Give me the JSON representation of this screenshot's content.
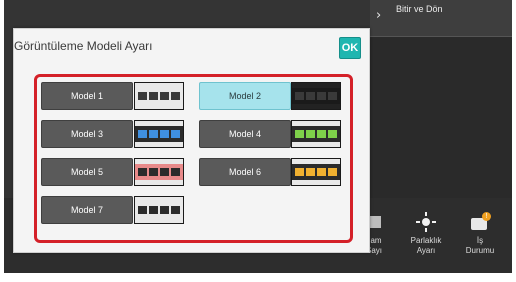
{
  "header": {
    "right_button_label": "Bitir ve Dön"
  },
  "dialog": {
    "title": "Görüntüleme Modeli Ayarı",
    "ok_label": "OK",
    "selected_model": "Model 2",
    "models": [
      {
        "label": "Model 1",
        "swatch": {
          "band": "#e9e9e9",
          "body": "#e9e9e9",
          "key": "#3a3a3a"
        }
      },
      {
        "label": "Model 2",
        "swatch": {
          "band": "#222222",
          "body": "#1a1a1a",
          "key": "#3a3a3a"
        }
      },
      {
        "label": "Model 3",
        "swatch": {
          "band": "#e9e9e9",
          "body": "#2b2b2b",
          "key": "#3f8fe0"
        }
      },
      {
        "label": "Model 4",
        "swatch": {
          "band": "#e9e9e9",
          "body": "#2b2b2b",
          "key": "#7ed04a"
        }
      },
      {
        "label": "Model 5",
        "swatch": {
          "band": "#e9e9e9",
          "body": "#e88a8a",
          "key": "#2b2b2b"
        }
      },
      {
        "label": "Model 6",
        "swatch": {
          "band": "#e9e9e9",
          "body": "#2b2b2b",
          "key": "#f0b030"
        }
      },
      {
        "label": "Model 7",
        "swatch": {
          "band": "#e9e9e9",
          "body": "#e9e9e9",
          "key": "#2b2b2b"
        }
      }
    ]
  },
  "bottom_bar": {
    "items": [
      {
        "label_line1": "ılam",
        "label_line2": "Sayı",
        "icon": "counter-icon"
      },
      {
        "label_line1": "Parlaklık",
        "label_line2": "Ayarı",
        "icon": "brightness-icon"
      },
      {
        "label_line1": "İş",
        "label_line2": "Durumu",
        "icon": "job-status-icon"
      }
    ]
  },
  "colors": {
    "accent": "#1fb6b0",
    "frame": "#d42028",
    "selected": "#a6e3ec"
  }
}
